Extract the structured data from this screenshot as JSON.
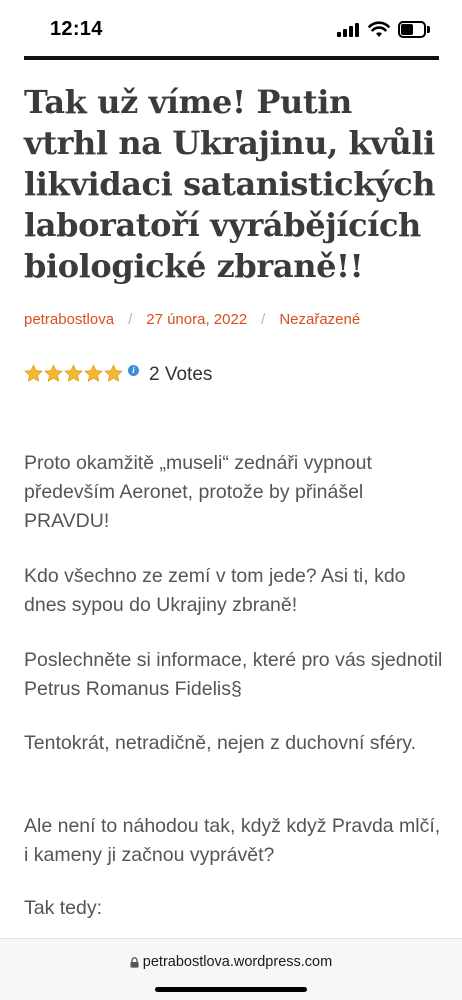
{
  "status_bar": {
    "time": "12:14"
  },
  "post": {
    "title": "Tak už víme! Putin vtrhl na Ukrajinu, kvůli likvidaci satanistických laboratoří vyrábějících biologické zbraně!!",
    "author": "petrabostlova",
    "date": "27 února, 2022",
    "category": "Nezařazené",
    "meta_separator": "/",
    "rating": {
      "stars": 5,
      "max_stars": 5,
      "votes_label": "2 Votes",
      "info_glyph": "i"
    },
    "paragraphs": [
      "Proto okamžitě „museli“ zednáři vypnout především Aeronet, protože by přinášel PRAVDU!",
      "Kdo všechno ze zemí v tom jede? Asi ti, kdo dnes sypou do Ukrajiny zbraně!",
      "Poslechněte si informace, které pro vás sjednotil Petrus Romanus Fidelis§",
      "Tentokrát, netradičně, nejen z duchovní sféry.",
      "Ale není to náhodou tak, když když Pravda mlčí, i kameny ji začnou vyprávět?",
      "Tak tedy:"
    ]
  },
  "browser": {
    "url": "petrabostlova.wordpress.com"
  },
  "icons": {
    "signal": "signal-bars-icon",
    "wifi": "wifi-icon",
    "battery": "battery-icon",
    "star": "star-icon",
    "info": "info-icon",
    "lock": "lock-icon"
  },
  "colors": {
    "accent": "#d84f1c",
    "title": "#3b3b3b",
    "body_text": "#555555",
    "star": "#f5b82e",
    "info": "#3a8fd8"
  }
}
